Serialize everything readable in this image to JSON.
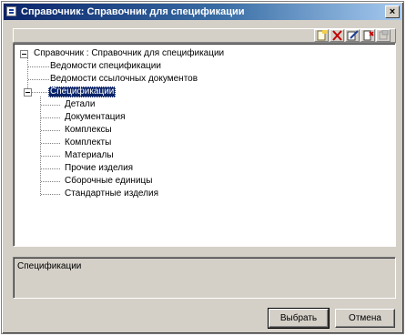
{
  "window": {
    "title": "Справочник: Справочник для спецификации",
    "close_glyph": "×"
  },
  "toolbar": {
    "buttons": [
      {
        "name": "new-item-icon"
      },
      {
        "name": "delete-icon"
      },
      {
        "name": "edit-icon"
      },
      {
        "name": "properties-icon"
      },
      {
        "name": "disabled-action-icon"
      }
    ]
  },
  "tree": {
    "root": "Справочник : Справочник для спецификации",
    "top_items": [
      "Ведомости спецификации",
      "Ведомости ссылочных документов"
    ],
    "selected_branch": "Спецификации",
    "children": [
      "Детали",
      "Документация",
      "Комплексы",
      "Комплекты",
      "Материалы",
      "Прочие изделия",
      "Сборочные единицы",
      "Стандартные изделия"
    ]
  },
  "status": {
    "text": "Спецификации"
  },
  "buttons": {
    "select": "Выбрать",
    "cancel": "Отмена"
  },
  "colors": {
    "title_gradient_start": "#0a246a",
    "title_gradient_end": "#a6caf0",
    "selection": "#0a246a",
    "face": "#d4d0c8"
  }
}
